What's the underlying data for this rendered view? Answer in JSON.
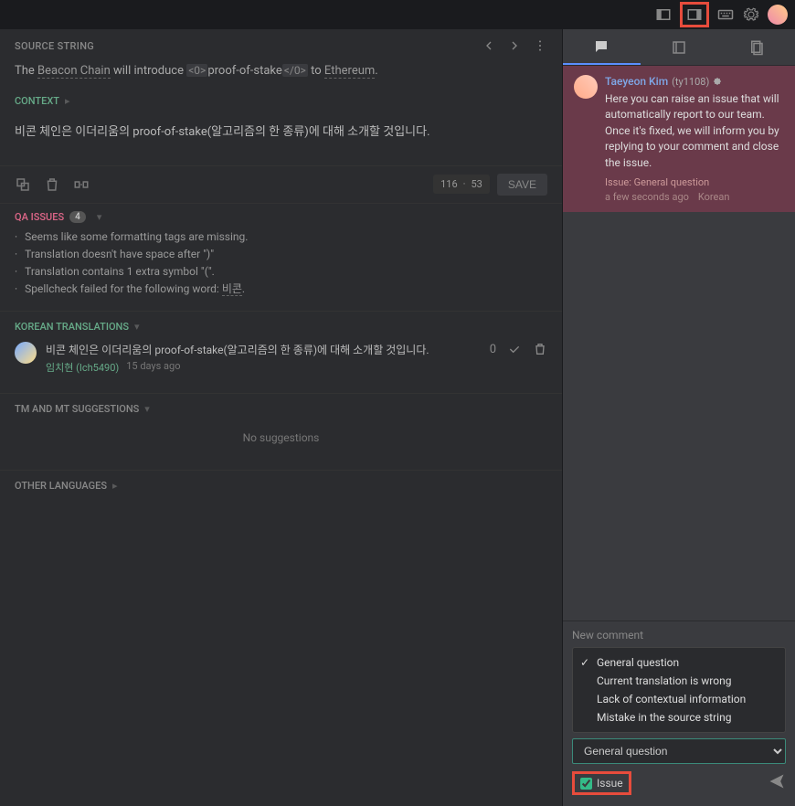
{
  "source_string_label": "SOURCE STRING",
  "source_text": {
    "pre": "The ",
    "link1": "Beacon Chain",
    "mid": " will introduce ",
    "tag_open": "<0>",
    "word": "proof-of-stake",
    "tag_close": "</0>",
    "to": " to ",
    "link2": "Ethereum",
    "end": "."
  },
  "context_label": "CONTEXT",
  "translation_text": "비콘 체인은 이더리움의 proof-of-stake(알고리즘의 한 종류)에 대해 소개할 것입니다.",
  "char_count": {
    "a": "116",
    "sep": "·",
    "b": "53"
  },
  "save_btn": "SAVE",
  "qa": {
    "title": "QA ISSUES",
    "count": "4",
    "items": [
      "Seems like some formatting tags are missing.",
      "Translation doesn't have space after \")\"",
      "Translation contains 1 extra symbol \"(\"."
    ],
    "spell_pre": "Spellcheck failed for the following word: ",
    "spell_word": "비콘",
    "spell_post": "."
  },
  "korean": {
    "title": "KOREAN TRANSLATIONS",
    "text": "비콘 체인은 이더리움의 proof-of-stake(알고리즘의 한 종류)에 대해 소개할 것입니다.",
    "user": "임치현 (Ich5490)",
    "time": "15 days ago",
    "votes": "0"
  },
  "tm": {
    "title": "TM AND MT SUGGESTIONS",
    "empty": "No suggestions"
  },
  "other_lang": "OTHER LANGUAGES",
  "comment": {
    "user": "Taeyeon Kim",
    "handle": "(ty1108)",
    "text": "Here you can raise an issue that will automatically report to our team. Once it's fixed, we will inform you by replying to your comment and close the issue.",
    "issue": "Issue: General question",
    "time": "a few seconds ago",
    "lang": "Korean"
  },
  "new_comment_label": "New comment",
  "dropdown": [
    "General question",
    "Current translation is wrong",
    "Lack of contextual information",
    "Mistake in the source string"
  ],
  "selected_issue": "General question",
  "issue_checkbox": "Issue"
}
